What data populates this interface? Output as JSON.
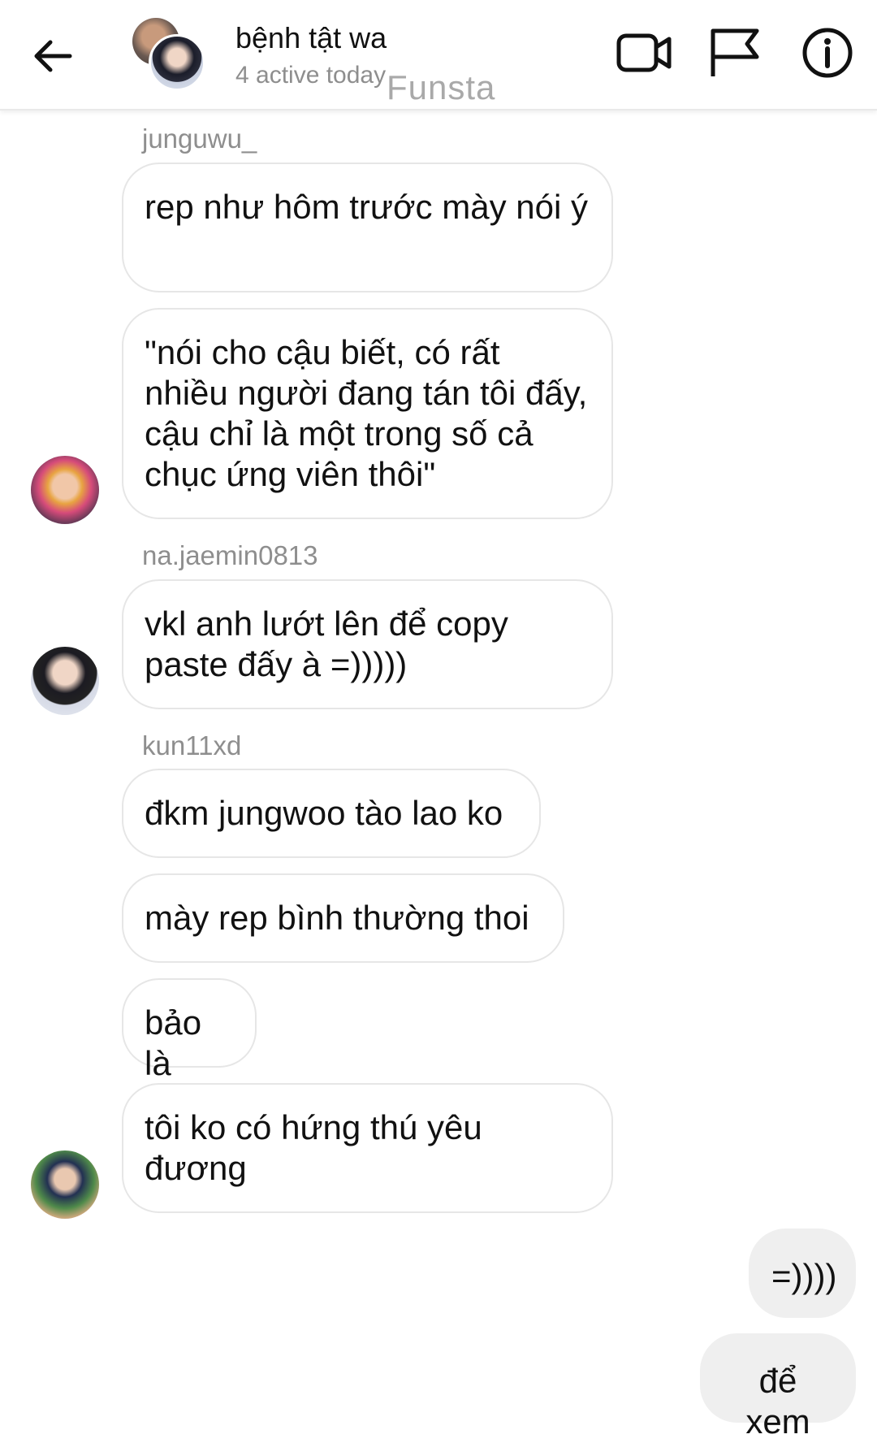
{
  "header": {
    "title": "bệnh tật wa",
    "subtitle": "4 active today",
    "watermark": "Funsta"
  },
  "messages": {
    "group1": {
      "username": "junguwu_",
      "bubbles": [
        "rep như hôm trước mày nói ý",
        "\"nói cho cậu biết, có rất nhiều người đang tán tôi đấy, cậu chỉ là một trong số cả chục ứng viên thôi\""
      ]
    },
    "group2": {
      "username": "na.jaemin0813",
      "bubbles": [
        "vkl anh lướt lên để copy paste đấy à =)))))"
      ]
    },
    "group3": {
      "username": "kun11xd",
      "bubbles": [
        "đkm jungwoo tào lao ko",
        "mày rep bình thường thoi",
        "bảo là",
        "tôi ko có hứng thú yêu đương"
      ]
    },
    "mine": [
      "=))))",
      "để xem"
    ]
  },
  "icons": [
    "arrow-left-icon",
    "video-call-icon",
    "flag-icon",
    "info-icon"
  ]
}
